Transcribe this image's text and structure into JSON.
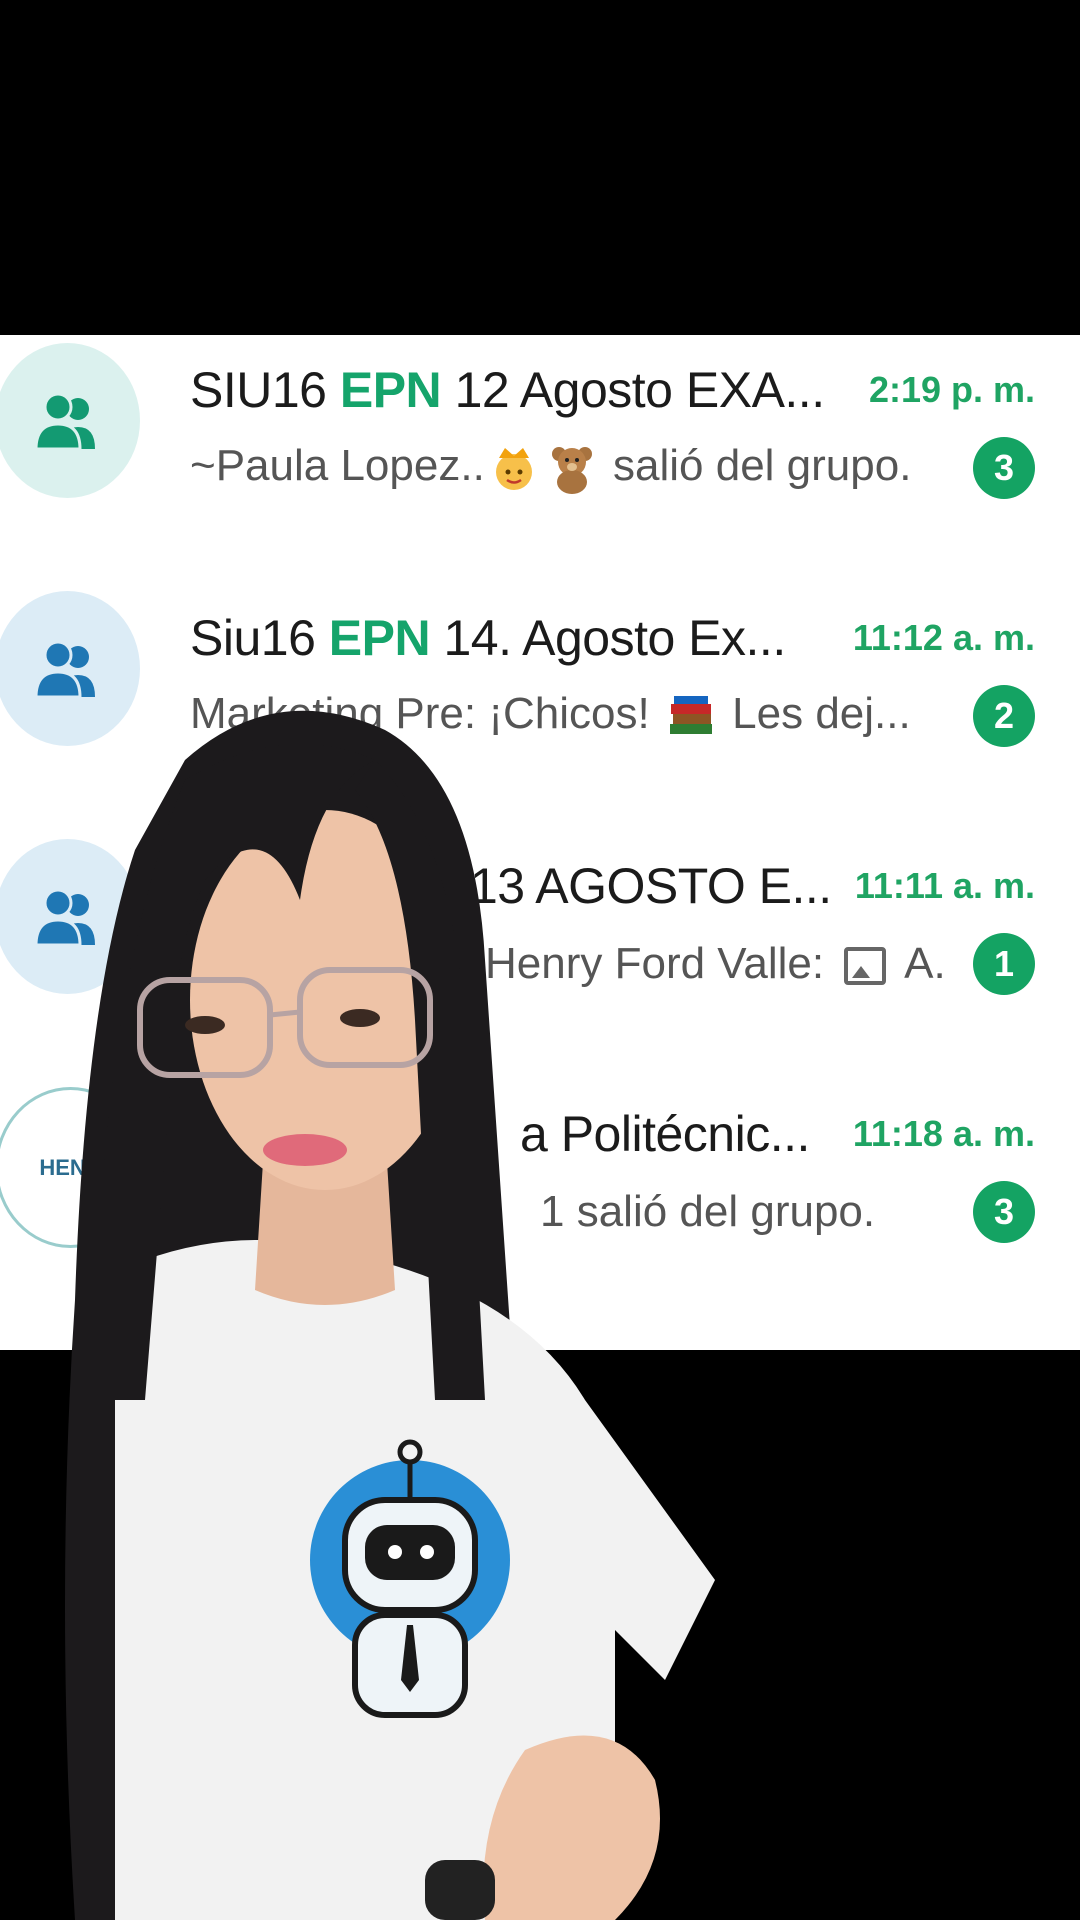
{
  "chats": [
    {
      "title_pre": "SIU16 ",
      "title_hl": "EPN",
      "title_post": " 12 Agosto EXA...",
      "time": "2:19 p. m.",
      "preview_pre": "~Paula Lopez..",
      "preview_post": " salió del grupo.",
      "unread": "3",
      "avatar_icon": "group-icon",
      "accent": "#15a46b"
    },
    {
      "title_pre": "Siu16 ",
      "title_hl": "EPN",
      "title_post": " 14. Agosto Ex...",
      "time": "11:12 a. m.",
      "preview_pre": "Marketing Pre: ¡Chicos! ",
      "preview_post": " Les dej...",
      "unread": "2",
      "avatar_icon": "group-icon"
    },
    {
      "title_pre": "",
      "title_hl": "",
      "title_post": "13 AGOSTO E...",
      "time": "11:11 a. m.",
      "preview_pre": "Henry Ford Valle: ",
      "preview_post": " A.",
      "unread": "1",
      "avatar_icon": "group-icon"
    },
    {
      "title_pre": "",
      "title_hl": "",
      "title_post": "a Politécnic...",
      "time": "11:18 a. m.",
      "preview_pre": "1 salió del grupo.",
      "preview_post": "",
      "unread": "3",
      "avatar_icon": "henry-logo",
      "avatar_text": "HENR"
    }
  ],
  "colors": {
    "accent": "#15a46b",
    "badge": "#14a363",
    "time": "#1fa463"
  }
}
